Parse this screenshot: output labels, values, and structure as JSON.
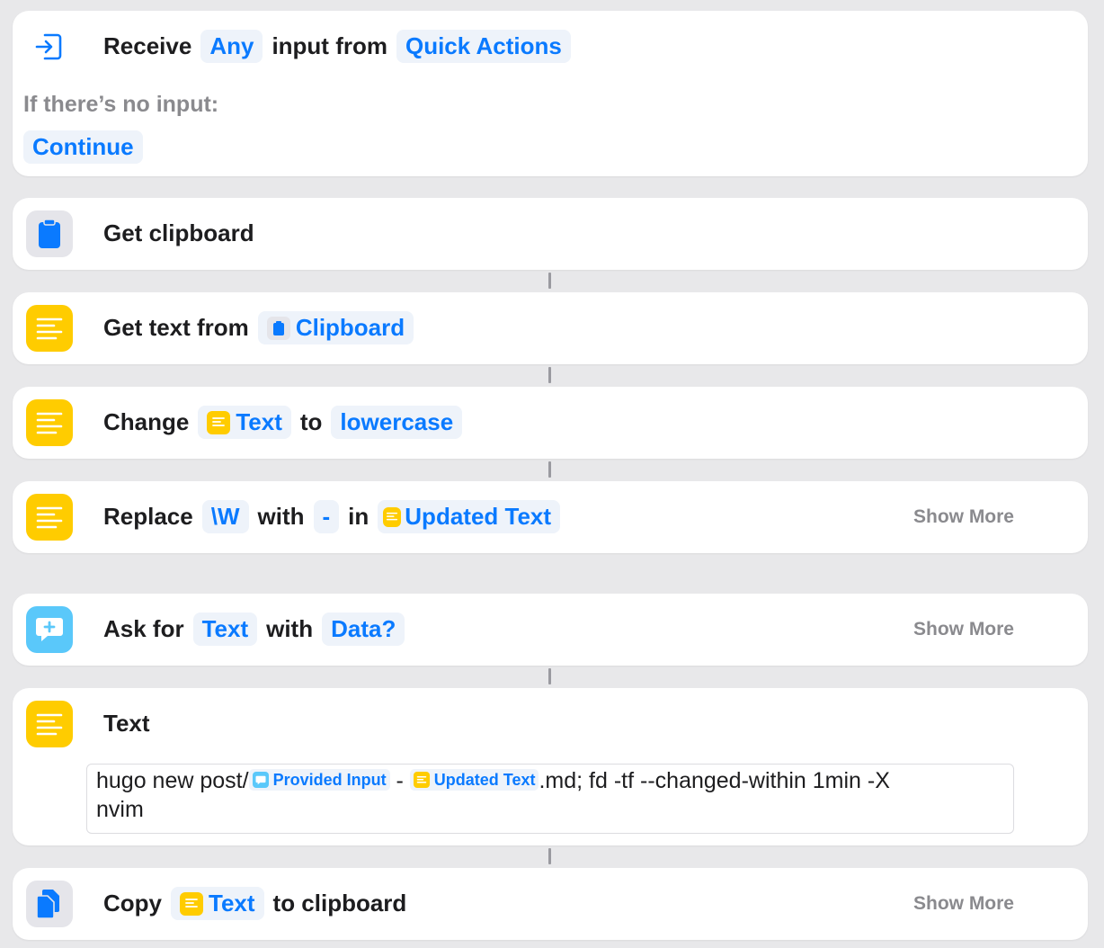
{
  "receive": {
    "label_receive": "Receive",
    "input_type": "Any",
    "label_input_from": "input from",
    "source": "Quick Actions",
    "no_input_label": "If there’s no input:",
    "no_input_action": "Continue"
  },
  "get_clipboard": {
    "label": "Get clipboard"
  },
  "get_text": {
    "label": "Get text from",
    "source": "Clipboard"
  },
  "change_case": {
    "label_change": "Change",
    "variable": "Text",
    "label_to": "to",
    "case": "lowercase"
  },
  "replace": {
    "label_replace": "Replace",
    "pattern": "\\W",
    "label_with": "with",
    "replacement": "-",
    "label_in": "in",
    "variable": "Updated Text",
    "show_more": "Show More"
  },
  "ask": {
    "label_ask_for": "Ask for",
    "input_type": "Text",
    "label_with": "with",
    "prompt": "Data?",
    "show_more": "Show More"
  },
  "text_action": {
    "title": "Text",
    "prefix": "hugo new post/",
    "var1": "Provided Input",
    "separator": " - ",
    "var2": "Updated Text",
    "suffix": ".md; fd -tf --changed-within 1min -X",
    "line2": "nvim"
  },
  "copy": {
    "label_copy": "Copy",
    "variable": "Text",
    "label_to_clipboard": "to clipboard",
    "show_more": "Show More"
  },
  "colors": {
    "accent": "#0a7aff",
    "yellow": "#ffcc00",
    "cyan": "#5ac8fa",
    "background": "#e8e8ea"
  }
}
